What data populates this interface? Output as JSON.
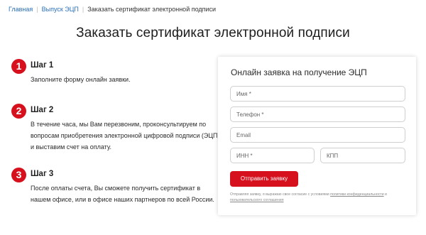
{
  "breadcrumb": {
    "items": [
      {
        "label": "Главная"
      },
      {
        "label": "Выпуск ЭЦП"
      }
    ],
    "current": "Заказать сертификат электронной подписи"
  },
  "page_title": "Заказать сертификат электронной подписи",
  "steps": [
    {
      "num": "1",
      "title": "Шаг 1",
      "text": "Заполните форму онлайн заявки."
    },
    {
      "num": "2",
      "title": "Шаг 2",
      "text": "В течение часа, мы Вам перезвоним, проконсультируем по вопросам приобретения электронной цифровой подписи (ЭЦП) и выставим счет на оплату."
    },
    {
      "num": "3",
      "title": "Шаг 3",
      "text": "После оплаты счета, Вы сможете получить сертификат в нашем офисе, или в офисе наших партнеров по всей России."
    }
  ],
  "form": {
    "title": "Онлайн заявка на получение ЭЦП",
    "name_placeholder": "Имя *",
    "phone_placeholder": "Телефон *",
    "email_placeholder": "Email",
    "inn_placeholder": "ИНН *",
    "kpp_placeholder": "КПП",
    "submit_label": "Отправить заявку",
    "consent_prefix": "Отправляя заявку, я выражаю свое согласие с условиями ",
    "consent_link1": "политики конфиденциальности",
    "consent_middle": " и ",
    "consent_link2": "пользовательского соглашения"
  },
  "colors": {
    "accent": "#d6111d",
    "link": "#2a6fb8"
  }
}
